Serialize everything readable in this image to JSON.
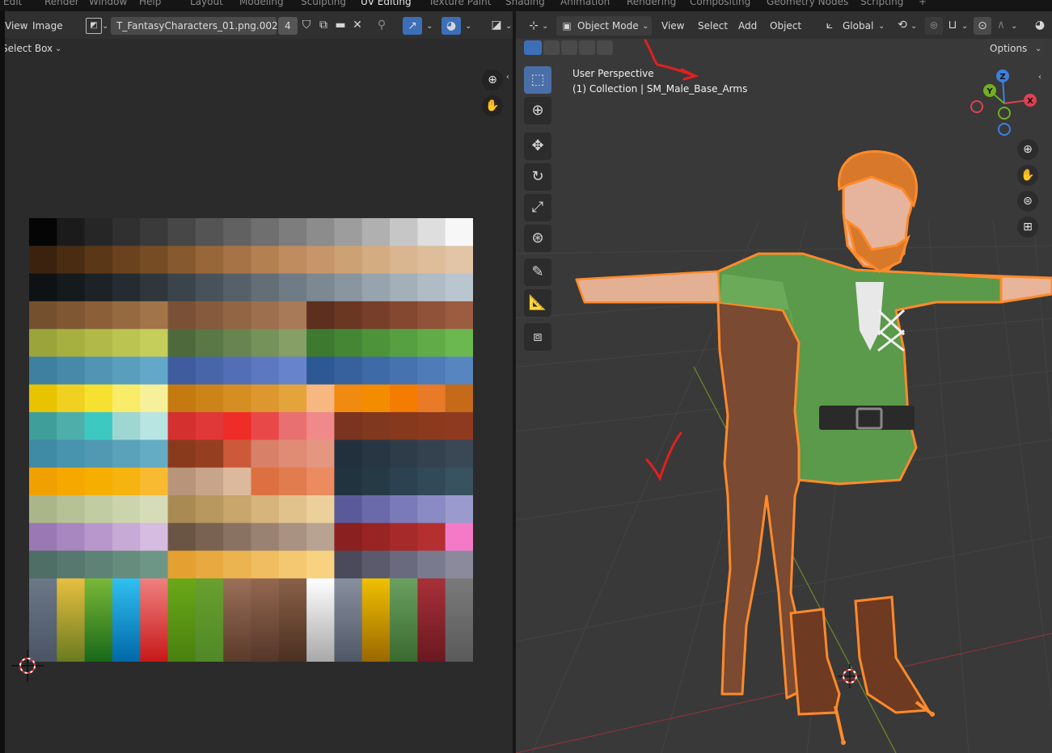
{
  "workspace_tabs": [
    "Edit",
    "Render",
    "Window",
    "Help",
    "Layout",
    "Modeling",
    "Sculpting",
    "UV Editing",
    "Texture Paint",
    "Shading",
    "Animation",
    "Rendering",
    "Compositing",
    "Geometry Nodes",
    "Scripting",
    "+"
  ],
  "uv_editor": {
    "menu_view": "View",
    "menu_image": "Image",
    "image_name": "T_FantasyCharacters_01.png.002",
    "users_count": "4",
    "select_mode": "Select Box"
  },
  "viewport": {
    "mode": "Object Mode",
    "menu": [
      "View",
      "Select",
      "Add",
      "Object"
    ],
    "transform_orientation": "Global",
    "options_label": "Options",
    "overlay_line1": "User Perspective",
    "overlay_line2": "(1) Collection | SM_Male_Base_Arms",
    "gizmo_labels": {
      "z": "Z",
      "y": "Y",
      "x": "X"
    }
  },
  "icons": {
    "uv_header": [
      "image-type-icon",
      "shield-icon",
      "copy-icon",
      "folder-icon",
      "close-icon",
      "pin-icon",
      "uv-sync-icon",
      "overlay-icon",
      "display-channels-icon"
    ],
    "tools": [
      "select-box-icon",
      "cursor-icon",
      "move-icon",
      "rotate-icon",
      "scale-icon",
      "transform-icon",
      "annotate-icon",
      "measure-icon",
      "add-cube-icon"
    ],
    "nav": [
      "zoom-icon",
      "hand-pan-icon",
      "camera-icon",
      "grid-ortho-icon"
    ]
  },
  "colors": {
    "accent_blue": "#3d6fb8",
    "selection_orange": "#ff8a2a",
    "annotation_red": "#e02020"
  },
  "palette_rows": [
    [
      "#050505",
      "#1b1b1b",
      "#262626",
      "#303030",
      "#3a3a3a",
      "#474747",
      "#545454",
      "#616161",
      "#6f6f6f",
      "#7d7d7d",
      "#8c8c8c",
      "#9d9d9d",
      "#b0b0b0",
      "#c6c6c6",
      "#dedede",
      "#f7f7f7"
    ],
    [
      "#3a220f",
      "#4a2c12",
      "#5a3717",
      "#6a421e",
      "#764c25",
      "#87592f",
      "#976639",
      "#a57345",
      "#b38051",
      "#bf8c5f",
      "#c6966a",
      "#cca174",
      "#d3ac82",
      "#d9b690",
      "#ddbd9a",
      "#e2c5a6"
    ],
    [
      "#0e1214",
      "#151a1d",
      "#1c2226",
      "#252c31",
      "#2f373d",
      "#3b444b",
      "#48525a",
      "#566069",
      "#636e77",
      "#6f7b85",
      "#7c8892",
      "#89959f",
      "#97a3ad",
      "#a3afb9",
      "#afbbc5",
      "#bac6cf"
    ],
    [
      "#74502f",
      "#7f5733",
      "#8b6039",
      "#966a41",
      "#a1744a",
      "#7a5136",
      "#865a3d",
      "#926545",
      "#9d6f4e",
      "#a87a57",
      "#5c2f1e",
      "#6a3723",
      "#773f29",
      "#844830",
      "#905238",
      "#9b5c40"
    ],
    [
      "#9aa43a",
      "#a6b040",
      "#b1ba48",
      "#bbc451",
      "#c5cd5b",
      "#4e6a3c",
      "#5a7746",
      "#688551",
      "#76925b",
      "#859f67",
      "#3d7a2f",
      "#448634",
      "#4d933a",
      "#57a041",
      "#61ac48",
      "#6bb850"
    ],
    [
      "#3f7f9f",
      "#4889a9",
      "#5194b4",
      "#5a9ebe",
      "#63a8c8",
      "#3f5c9e",
      "#4865aa",
      "#526fb5",
      "#5c79c0",
      "#6784cb",
      "#2e5893",
      "#36619c",
      "#3e6aa5",
      "#4673ae",
      "#4f7cb7",
      "#5785bf"
    ],
    [
      "#e7c300",
      "#f0d020",
      "#f6e030",
      "#f8ec68",
      "#f7f09a",
      "#c47a10",
      "#cc8418",
      "#d48e22",
      "#dc982e",
      "#e4a43c",
      "#f6b780",
      "#f08a10",
      "#f48c00",
      "#f47c00",
      "#e87a28",
      "#c46a18"
    ],
    [
      "#3f9e9a",
      "#4eaeaa",
      "#3ec8c2",
      "#9ed6d2",
      "#b8e4e2",
      "#d43030",
      "#e03838",
      "#ee2c28",
      "#e84848",
      "#e87070",
      "#f08a8a",
      "#7a3420",
      "#80381e",
      "#86391c",
      "#8c3a1e",
      "#8e3a20"
    ],
    [
      "#3f8aa4",
      "#4894ae",
      "#5199b2",
      "#5aa2ba",
      "#63acc4",
      "#8a3a1c",
      "#963e20",
      "#cc5a3a",
      "#d88068",
      "#e08c74",
      "#e49680",
      "#22303e",
      "#283644",
      "#2e3c4a",
      "#344250",
      "#3a4856"
    ],
    [
      "#f0a000",
      "#f4a800",
      "#f6ae00",
      "#f6b410",
      "#f8ba30",
      "#b8957a",
      "#c8a58a",
      "#dcb89c",
      "#dc7040",
      "#e07c4e",
      "#ec8a60",
      "#223340",
      "#263a46",
      "#2c4250",
      "#324a58",
      "#385260"
    ],
    [
      "#aab68a",
      "#b6c296",
      "#c2cca2",
      "#ccd4ae",
      "#d6dcb8",
      "#a88a52",
      "#b8985e",
      "#c8a66c",
      "#d6b47c",
      "#e2c28c",
      "#ecd09c",
      "#5a5a9a",
      "#6a6aaa",
      "#7a7ab8",
      "#8a8ac4",
      "#9a9acc"
    ],
    [
      "#9a78b4",
      "#a886c0",
      "#b898cc",
      "#c8aad6",
      "#d6bce0",
      "#6a5444",
      "#7a6252",
      "#8a7262",
      "#9a8272",
      "#aa9282",
      "#b8a292",
      "#8a2020",
      "#982424",
      "#a62a2a",
      "#b43030",
      "#f47ac8"
    ],
    [
      "#4e6e66",
      "#56786e",
      "#5e8276",
      "#668c7e",
      "#6e9686",
      "#e4a030",
      "#e8aa40",
      "#ecb450",
      "#f0be60",
      "#f4c870",
      "#f8d280",
      "#4a4a5a",
      "#5a5a6c",
      "#6a6a7e",
      "#7a7a8e",
      "#8a8a9c"
    ]
  ],
  "palette_bottom": [
    [
      "#6c7888",
      "#4a5464"
    ],
    [
      "#e8c040",
      "#6a7a20"
    ],
    [
      "#7ab838",
      "#186818"
    ],
    [
      "#30c0f0",
      "#0068a8"
    ],
    [
      "#f08080",
      "#c81818"
    ],
    [
      "#6aa818",
      "#4a8010"
    ],
    [
      "#68a030",
      "#508828"
    ],
    [
      "#9a7058",
      "#5a3a2a"
    ],
    [
      "#946850",
      "#54362a"
    ],
    [
      "#8a6048",
      "#4a3020"
    ],
    [
      "#ffffff",
      "#a8a8a8"
    ],
    [
      "#8890a0",
      "#505868"
    ],
    [
      "#f0c000",
      "#9a6800"
    ],
    [
      "#6aa060",
      "#3a6a30"
    ],
    [
      "#a83038",
      "#6a1820"
    ],
    [
      "#7a7a7a",
      "#5a5a5a"
    ]
  ]
}
